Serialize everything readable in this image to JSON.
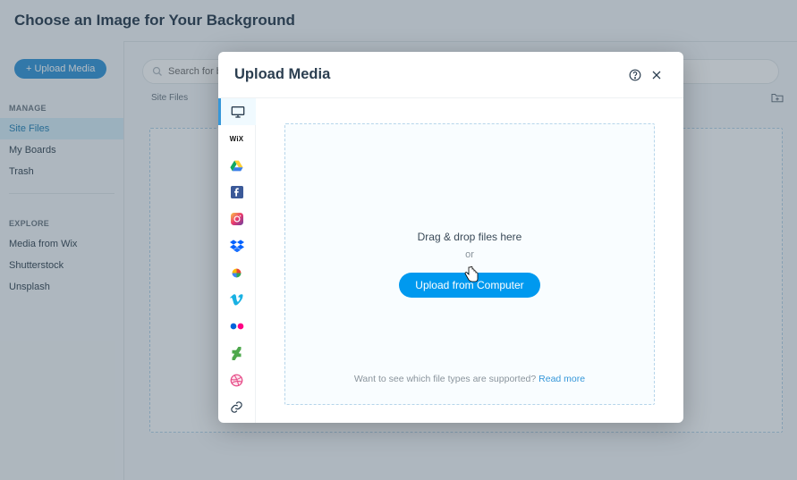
{
  "page_title": "Choose an Image for Your Background",
  "sidebar": {
    "upload_btn": "+ Upload Media",
    "manage_label": "MANAGE",
    "manage_items": [
      "Site Files",
      "My Boards",
      "Trash"
    ],
    "active_manage": 0,
    "explore_label": "EXPLORE",
    "explore_items": [
      "Media from Wix",
      "Shutterstock",
      "Unsplash"
    ]
  },
  "main": {
    "search_placeholder": "Search for bu",
    "breadcrumb": "Site Files"
  },
  "modal": {
    "title": "Upload Media",
    "sources": [
      {
        "id": "computer-icon"
      },
      {
        "id": "wix-icon"
      },
      {
        "id": "google-drive-icon"
      },
      {
        "id": "facebook-icon"
      },
      {
        "id": "instagram-icon"
      },
      {
        "id": "dropbox-icon"
      },
      {
        "id": "google-photos-icon"
      },
      {
        "id": "vimeo-icon"
      },
      {
        "id": "flickr-icon"
      },
      {
        "id": "deviantart-icon"
      },
      {
        "id": "dribbble-icon"
      },
      {
        "id": "link-icon"
      }
    ],
    "drag_text": "Drag & drop files here",
    "or_text": "or",
    "upload_btn": "Upload from Computer",
    "support_text": "Want to see which file types are supported? ",
    "support_link": "Read more"
  }
}
